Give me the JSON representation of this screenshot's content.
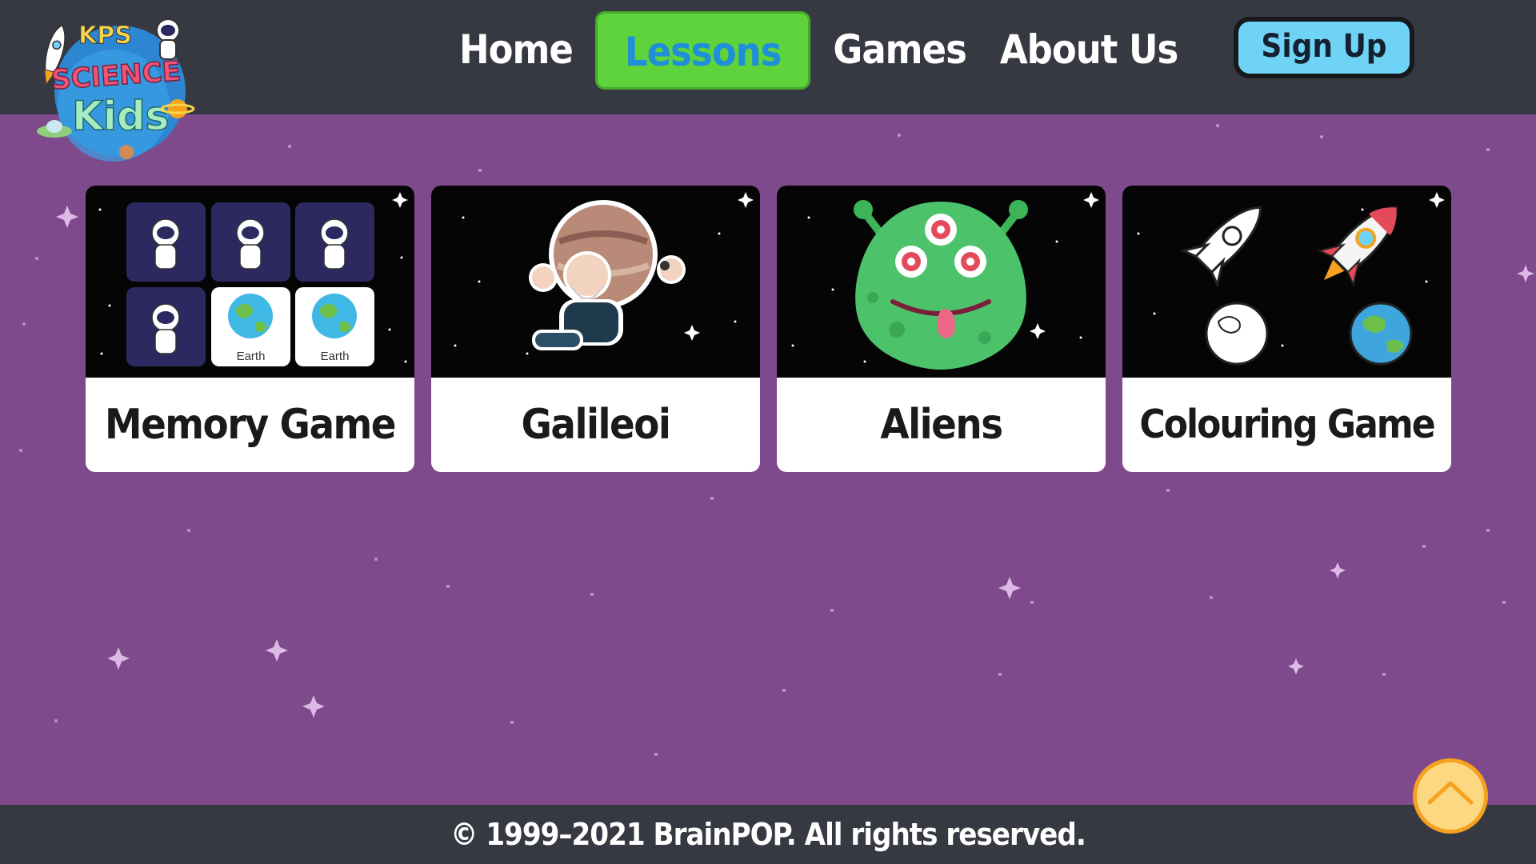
{
  "brand": {
    "logo_line1": "KPS",
    "logo_line2": "SCIENCE",
    "logo_line3": "Kids"
  },
  "nav": {
    "items": [
      {
        "label": "Home",
        "active": false
      },
      {
        "label": "Lessons",
        "active": true
      },
      {
        "label": "Games",
        "active": false
      },
      {
        "label": "About Us",
        "active": false
      }
    ],
    "signup_label": "Sign Up"
  },
  "cards": [
    {
      "title": "Memory Game",
      "tiles": [
        "",
        "",
        "",
        "",
        "Earth",
        "Earth"
      ]
    },
    {
      "title": "Galileoi"
    },
    {
      "title": "Aliens"
    },
    {
      "title": "Colouring Game"
    }
  ],
  "footer": {
    "copyright": "© 1999–2021 BrainPOP. All rights reserved."
  },
  "colors": {
    "background": "#7e4a8c",
    "header": "#363942",
    "active_tab": "#5fd33b",
    "active_text": "#1e8fd8",
    "signup": "#6ed3f4",
    "scroll_top": "#fdd883"
  }
}
